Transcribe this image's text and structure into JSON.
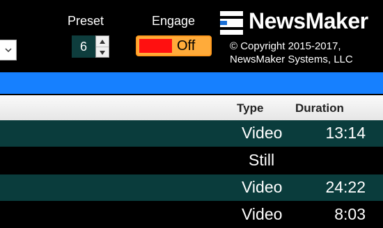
{
  "controls": {
    "preset_label": "Preset",
    "preset_value": "6",
    "engage_label": "Engage",
    "engage_state": "Off"
  },
  "brand": {
    "name": "NewsMaker",
    "copyright_line1": "© Copyright 2015-2017,",
    "copyright_line2": "NewsMaker Systems, LLC"
  },
  "table": {
    "headers": {
      "type": "Type",
      "duration": "Duration"
    },
    "rows": [
      {
        "type": "Video",
        "duration": "13:14"
      },
      {
        "type": "Still",
        "duration": ""
      },
      {
        "type": "Video",
        "duration": "24:22"
      },
      {
        "type": "Video",
        "duration": "8:03"
      }
    ]
  },
  "colors": {
    "accent_blue": "#1680ff",
    "row_dark": "#0a3c3c",
    "engage_red": "#ff1010",
    "engage_orange": "#ffab3a"
  }
}
